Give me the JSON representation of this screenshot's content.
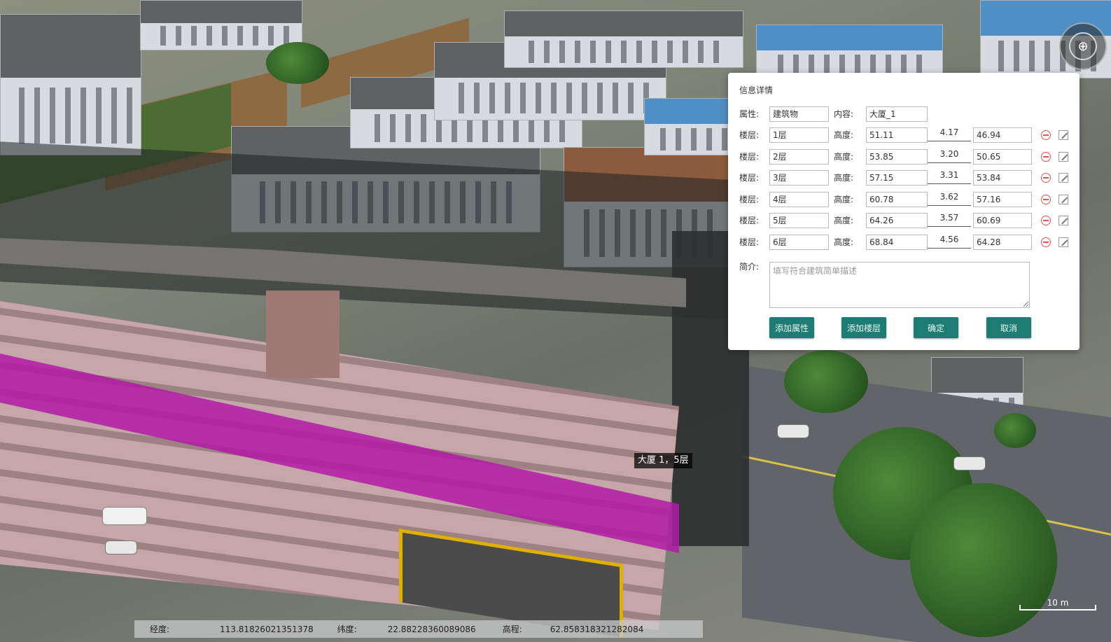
{
  "map": {
    "building_label": "大厦 1，5层",
    "scale_label": "10 m",
    "compass_symbol": "⊕"
  },
  "status_bar": {
    "longitude_label": "经度:",
    "longitude_value": "113.81826021351378",
    "latitude_label": "纬度:",
    "latitude_value": "22.88228360089086",
    "elevation_label": "高程:",
    "elevation_value": "62.858318321282084"
  },
  "dialog": {
    "title": "信息详情",
    "attribute_label": "属性:",
    "attribute_value": "建筑物",
    "content_label": "内容:",
    "content_value": "大厦_1",
    "floor_label": "楼层:",
    "height_label": "高度:",
    "floors": [
      {
        "floor": "1层",
        "height": "51.11",
        "diff": "4.17",
        "base": "46.94"
      },
      {
        "floor": "2层",
        "height": "53.85",
        "diff": "3.20",
        "base": "50.65"
      },
      {
        "floor": "3层",
        "height": "57.15",
        "diff": "3.31",
        "base": "53.84"
      },
      {
        "floor": "4层",
        "height": "60.78",
        "diff": "3.62",
        "base": "57.16"
      },
      {
        "floor": "5层",
        "height": "64.26",
        "diff": "3.57",
        "base": "60.69"
      },
      {
        "floor": "6层",
        "height": "68.84",
        "diff": "4.56",
        "base": "64.28"
      }
    ],
    "intro_label": "简介:",
    "intro_placeholder": "填写符合建筑简单描述",
    "buttons": {
      "add_attribute": "添加属性",
      "add_floor": "添加楼层",
      "confirm": "确定",
      "cancel": "取消"
    }
  },
  "colors": {
    "button_bg": "#1d7d74",
    "floor_highlight": "#b11aa6",
    "delete_icon": "#e05454"
  }
}
